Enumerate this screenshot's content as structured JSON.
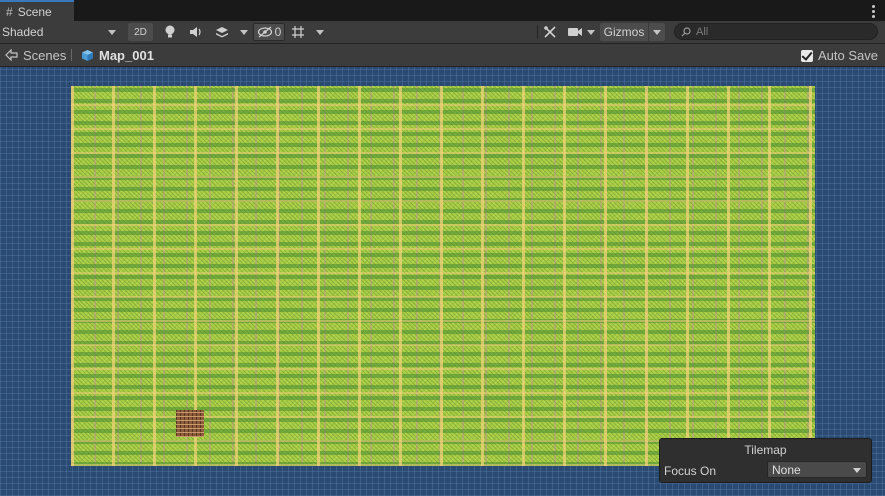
{
  "tab": {
    "title": "Scene",
    "icon": "grid-hash-icon"
  },
  "toolbar": {
    "shading_mode": "Shaded",
    "mode_2d": "2D",
    "hidden_count": "0",
    "gizmos_label": "Gizmos",
    "search_placeholder": "All"
  },
  "breadcrumb": {
    "root": "Scenes",
    "current": "Map_001"
  },
  "autosave": {
    "label": "Auto Save",
    "checked": true
  },
  "overlay": {
    "title": "Tilemap",
    "focus_label": "Focus On",
    "focus_value": "None"
  },
  "colors": {
    "accent": "#3a79bb",
    "scene_background": "#2b4a72",
    "grass": "#a9cc45"
  }
}
